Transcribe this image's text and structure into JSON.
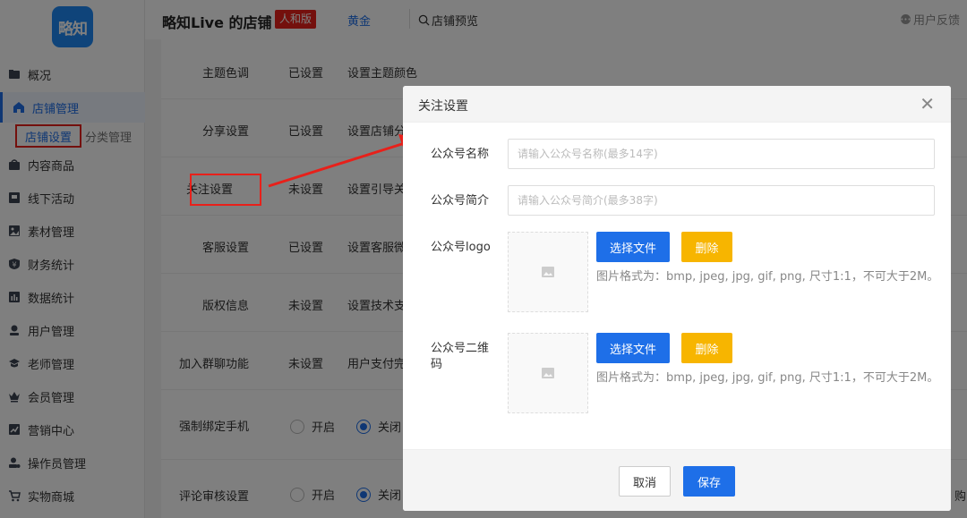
{
  "sidebar": {
    "logo_text": "略知",
    "items": [
      {
        "label": "概况",
        "icon": "overview-icon"
      },
      {
        "label": "店铺管理",
        "icon": "store-icon"
      },
      {
        "label": "内容商品",
        "icon": "content-icon"
      },
      {
        "label": "线下活动",
        "icon": "flag-icon"
      },
      {
        "label": "素材管理",
        "icon": "image-icon"
      },
      {
        "label": "财务统计",
        "icon": "yen-icon"
      },
      {
        "label": "数据统计",
        "icon": "bar-chart-icon"
      },
      {
        "label": "用户管理",
        "icon": "user-icon"
      },
      {
        "label": "老师管理",
        "icon": "graduation-cap-icon"
      },
      {
        "label": "会员管理",
        "icon": "crown-icon"
      },
      {
        "label": "营销中心",
        "icon": "trend-icon"
      },
      {
        "label": "操作员管理",
        "icon": "operator-icon"
      },
      {
        "label": "实物商城",
        "icon": "cart-icon"
      }
    ],
    "sub_items": [
      {
        "label": "店铺设置"
      },
      {
        "label": "分类管理"
      }
    ]
  },
  "header": {
    "title": "略知Live 的店铺",
    "badge": "人和版",
    "plan": "黄金",
    "preview": "店铺预览",
    "feedback": "用户反馈"
  },
  "settings": {
    "rows": [
      {
        "label": "主题色调",
        "status": "已设置",
        "action": "设置主题颜色"
      },
      {
        "label": "分享设置",
        "status": "已设置",
        "action": "设置店铺分"
      },
      {
        "label": "关注设置",
        "status": "未设置",
        "action": "设置引导关"
      },
      {
        "label": "客服设置",
        "status": "已设置",
        "action": "设置客服微"
      },
      {
        "label": "版权信息",
        "status": "未设置",
        "action": "设置技术支"
      },
      {
        "label": "加入群聊功能",
        "status": "未设置",
        "action": "用户支付完"
      }
    ],
    "toggles": [
      {
        "label": "强制绑定手机",
        "on_label": "开启",
        "off_label": "关闭"
      },
      {
        "label": "评论审核设置",
        "on_label": "开启",
        "off_label": "关闭"
      }
    ],
    "edge_text": "购"
  },
  "modal": {
    "title": "关注设置",
    "fields": {
      "name_label": "公众号名称",
      "name_placeholder": "请输入公众号名称(最多14字)",
      "intro_label": "公众号简介",
      "intro_placeholder": "请输入公众号简介(最多38字)",
      "logo_label": "公众号logo",
      "qr_label": "公众号二维码"
    },
    "choose_file": "选择文件",
    "delete": "删除",
    "hint": "图片格式为：bmp, jpeg, jpg, gif, png, 尺寸1:1，不可大于2M。",
    "cancel": "取消",
    "save": "保存"
  },
  "colors": {
    "accent": "#1e6fe8",
    "warning": "#f7b500",
    "highlight": "#e8201a"
  }
}
